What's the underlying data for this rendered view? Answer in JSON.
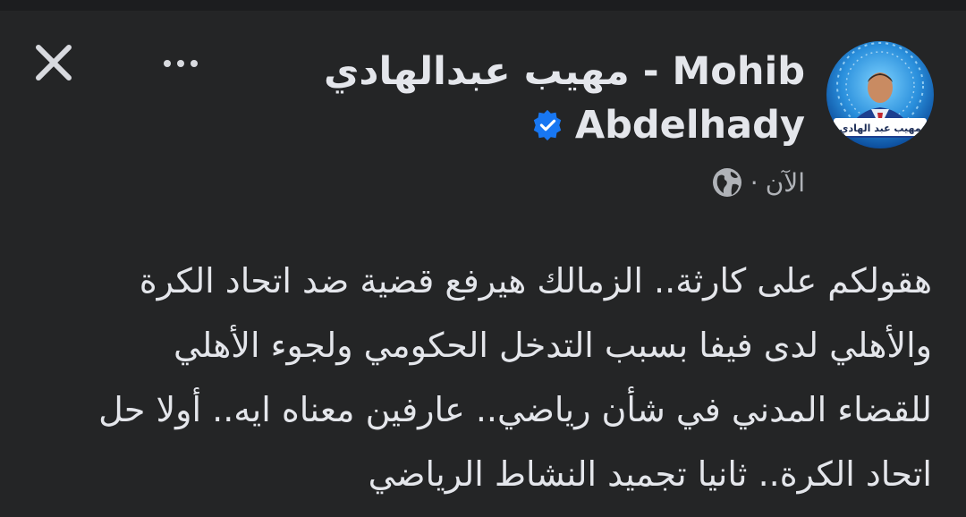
{
  "post": {
    "author_line1": "مهيب عبدالهادي - Mohib",
    "author_line2": "Abdelhady",
    "verified_icon": "verified-badge-icon",
    "time": "الآن",
    "separator": "·",
    "privacy_icon": "globe-icon",
    "text_lines": [
      "هقولكم على كارثة.. الزمالك هيرفع قضية ضد اتحاد الكرة",
      "والأهلي لدى فيفا بسبب التدخل الحكومي ولجوء الأهلي",
      "للقضاء المدني في شأن رياضي.. عارفين معناه ايه.. أولا حل",
      "اتحاد الكرة.. ثانيا تجميد النشاط الرياضي"
    ]
  },
  "avatar": {
    "caption": "مهيب عبد الهادي"
  },
  "toolbar": {
    "close_icon": "close-icon",
    "more_icon": "more-options-icon"
  },
  "colors": {
    "background": "#242526",
    "text": "#e4e6eb",
    "secondary_text": "#b0b3b8",
    "verified_blue": "#1877f2"
  }
}
